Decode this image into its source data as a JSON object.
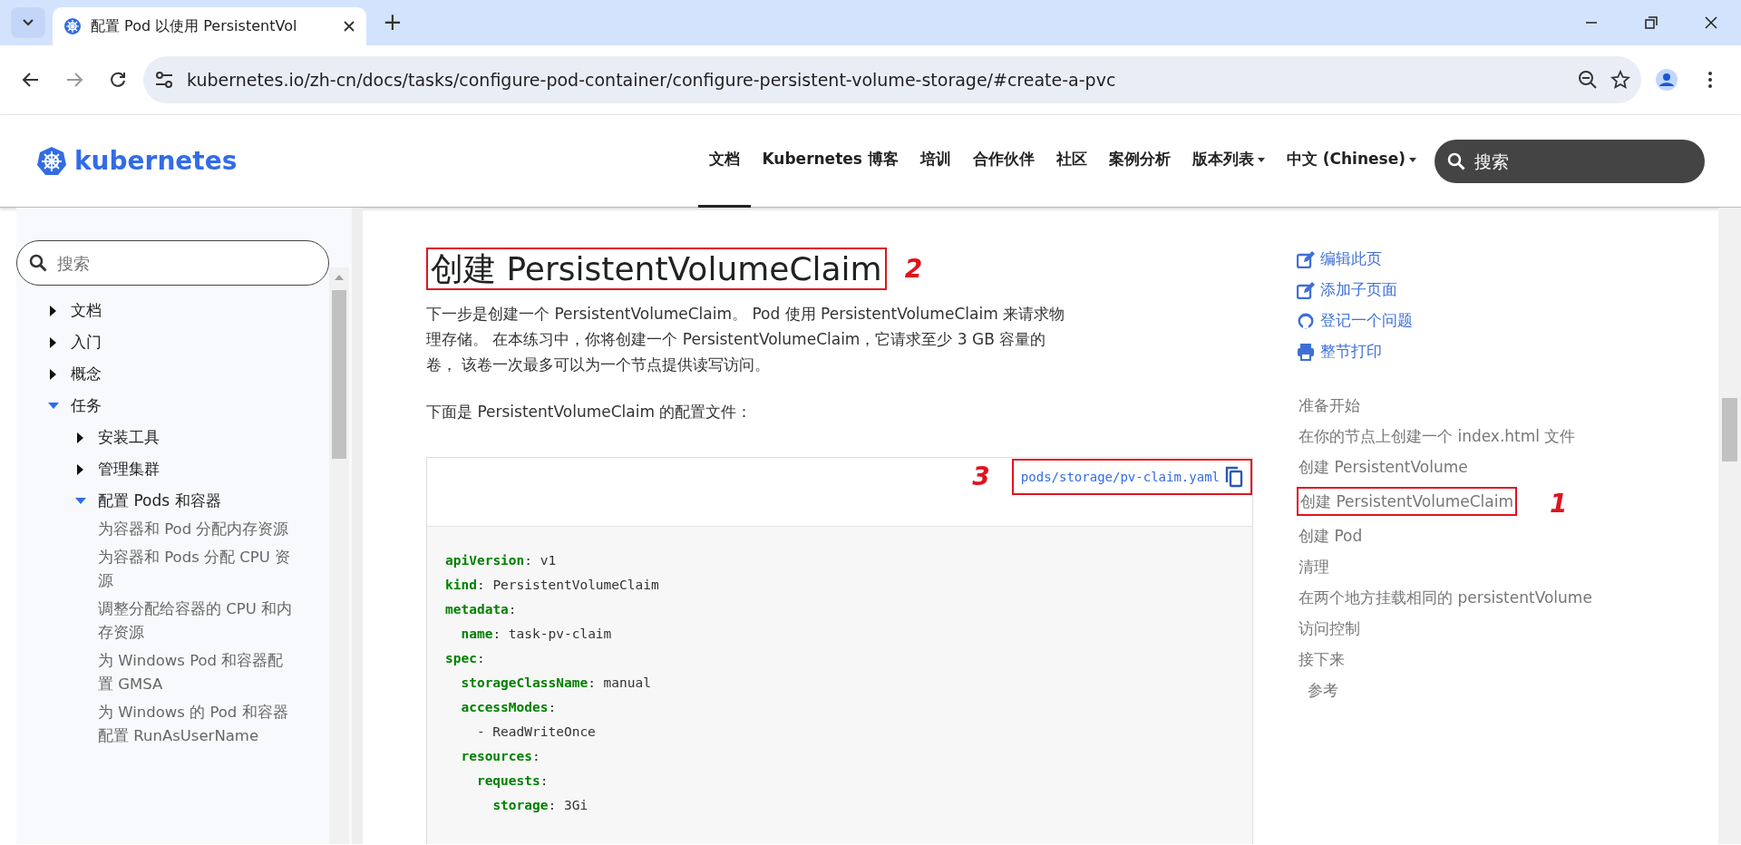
{
  "browser": {
    "tab_title": "配置 Pod 以使用 PersistentVol",
    "new_tab": "+",
    "url": "kubernetes.io/zh-cn/docs/tasks/configure-pod-container/configure-persistent-volume-storage/#create-a-pvc"
  },
  "site_header": {
    "logo": "kubernetes",
    "nav": [
      {
        "label": "文档",
        "selected": true,
        "dropdown": false
      },
      {
        "label": "Kubernetes 博客",
        "selected": false,
        "dropdown": false
      },
      {
        "label": "培训",
        "selected": false,
        "dropdown": false
      },
      {
        "label": "合作伙伴",
        "selected": false,
        "dropdown": false
      },
      {
        "label": "社区",
        "selected": false,
        "dropdown": false
      },
      {
        "label": "案例分析",
        "selected": false,
        "dropdown": false
      },
      {
        "label": "版本列表",
        "selected": false,
        "dropdown": true
      },
      {
        "label": "中文 (Chinese)",
        "selected": false,
        "dropdown": true
      }
    ],
    "search": {
      "placeholder": "搜索"
    }
  },
  "sidebar": {
    "search": {
      "placeholder": "搜索"
    },
    "tree": [
      {
        "label": "文档",
        "expanded": false
      },
      {
        "label": "入门",
        "expanded": false
      },
      {
        "label": "概念",
        "expanded": false
      },
      {
        "label": "任务",
        "expanded": true,
        "children": [
          {
            "label": "安装工具",
            "expanded": false
          },
          {
            "label": "管理集群",
            "expanded": false
          },
          {
            "label": "配置 Pods 和容器",
            "expanded": true,
            "children": [
              {
                "label": "为容器和 Pod 分配内存资源"
              },
              {
                "label": "为容器和 Pods 分配 CPU 资源"
              },
              {
                "label": "调整分配给容器的 CPU 和内存资源"
              },
              {
                "label": "为 Windows Pod 和容器配置 GMSA"
              },
              {
                "label": "为 Windows 的 Pod 和容器配置 RunAsUserName"
              }
            ]
          }
        ]
      }
    ]
  },
  "main": {
    "heading": "创建 PersistentVolumeClaim",
    "heading_annotation": "2",
    "paragraphs": [
      "下一步是创建一个 PersistentVolumeClaim。 Pod 使用 PersistentVolumeClaim 来请求物理存储。 在本练习中，你将创建一个 PersistentVolumeClaim，它请求至少 3 GB 容量的卷， 该卷一次最多可以为一个节点提供读写访问。",
      "下面是 PersistentVolumeClaim 的配置文件："
    ],
    "code_block": {
      "file_link": "pods/storage/pv-claim.yaml",
      "annotation": "3",
      "lines": [
        {
          "key": "apiVersion",
          "rest": ": v1"
        },
        {
          "key": "kind",
          "rest": ": PersistentVolumeClaim"
        },
        {
          "key": "metadata",
          "rest": ":",
          "children": [
            {
              "key": "name",
              "rest": ": task-pv-claim"
            }
          ]
        },
        {
          "key": "spec",
          "rest": ":",
          "children": [
            {
              "key": "storageClassName",
              "rest": ": manual"
            },
            {
              "key": "accessModes",
              "rest": ":",
              "children": [
                {
                  "rest": "- ReadWriteOnce"
                }
              ]
            },
            {
              "key": "resources",
              "rest": ":",
              "children": [
                {
                  "key": "requests",
                  "rest": ":",
                  "children": [
                    {
                      "key": "storage",
                      "rest": ": 3Gi"
                    }
                  ]
                }
              ]
            }
          ]
        }
      ]
    }
  },
  "page_actions": [
    {
      "kind": "edit",
      "label": "编辑此页"
    },
    {
      "kind": "edit",
      "label": "添加子页面"
    },
    {
      "kind": "github",
      "label": "登记一个问题"
    },
    {
      "kind": "print",
      "label": "整节打印"
    }
  ],
  "toc": [
    {
      "label": "准备开始"
    },
    {
      "label": "在你的节点上创建一个 index.html 文件"
    },
    {
      "label": "创建 PersistentVolume"
    },
    {
      "label": "创建 PersistentVolumeClaim",
      "annotation": "1"
    },
    {
      "label": "创建 Pod"
    },
    {
      "label": "清理"
    },
    {
      "label": "在两个地方挂载相同的 persistentVolume"
    },
    {
      "label": "访问控制"
    },
    {
      "label": "接下来",
      "children": [
        {
          "label": "参考"
        }
      ]
    }
  ]
}
